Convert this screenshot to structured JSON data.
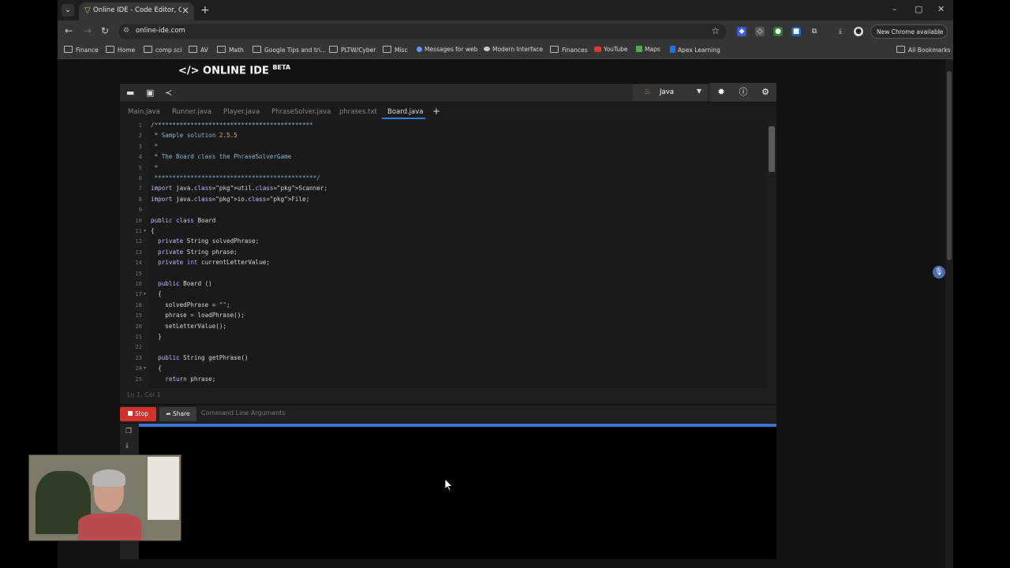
{
  "browser": {
    "tab_title": "Online IDE - Code Editor, Comp",
    "url": "online-ide.com",
    "new_chrome": "New Chrome available",
    "bookmarks": [
      "Finance",
      "Home",
      "comp sci",
      "AV",
      "Math",
      "Google Tips and tri...",
      "PLTW/Cyber",
      "Misc",
      "Messages for web",
      "Modern Interface",
      "Finances",
      "YouTube",
      "Maps",
      "Apex Learning"
    ],
    "all_bookmarks": "All Bookmarks"
  },
  "ide": {
    "logo": "</> ONLINE IDE",
    "logo_beta": "BETA",
    "language": "Java",
    "tabs": [
      "Main.java",
      "Runner.java",
      "Player.java",
      "PhraseSolver.java",
      "phrases.txt",
      "Board.java"
    ],
    "active_tab": "Board.java",
    "status": "Ln 1, Col 1",
    "stop_label": "Stop",
    "share_label": "Share",
    "cmd_args_placeholder": "Command Line Arguments"
  },
  "code_lines": [
    "/********************************************",
    " * Sample solution 2.5.5",
    " *",
    " * The Board class the PhraseSolverGame",
    " *",
    " *********************************************/",
    "import java.util.Scanner;",
    "import java.io.File;",
    "",
    "public class Board",
    "{",
    "  private String solvedPhrase;",
    "  private String phrase;",
    "  private int currentLetterValue;",
    "",
    "  public Board ()",
    "  {",
    "    solvedPhrase = \"\";",
    "    phrase = loadPhrase();",
    "    setLetterValue();",
    "  }",
    "",
    "  public String getPhrase()",
    "  {",
    "    return phrase;"
  ],
  "colors": {
    "stop": "#d3312a",
    "progress": "#3a78d8",
    "active_tab_underline": "#2d7cd6"
  }
}
